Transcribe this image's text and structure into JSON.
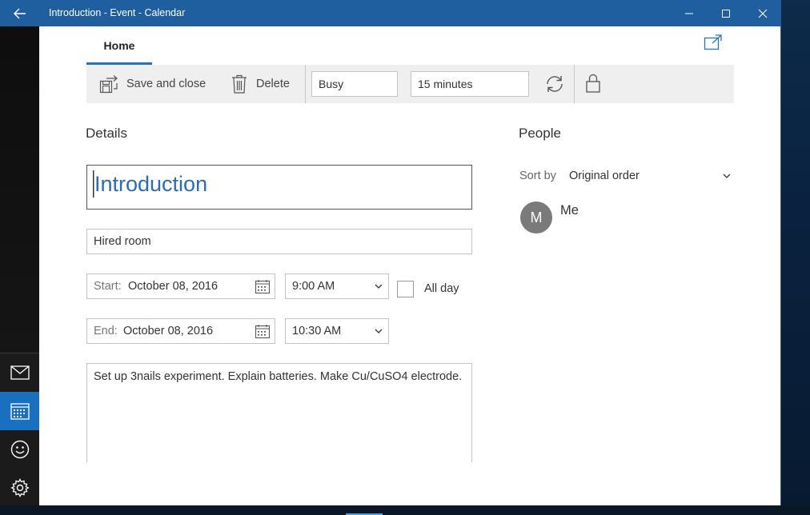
{
  "window": {
    "title": "Introduction - Event - Calendar"
  },
  "ribbon": {
    "tab_home": "Home",
    "save_close": "Save and close",
    "delete": "Delete",
    "show_as": "Busy",
    "reminder": "15 minutes"
  },
  "details": {
    "heading": "Details",
    "subject": "Introduction",
    "location": "Hired room",
    "start_label": "Start:",
    "start_date": "October 08, 2016",
    "start_time": "9:00 AM",
    "end_label": "End:",
    "end_date": "October 08, 2016",
    "end_time": "10:30 AM",
    "all_day": "All day",
    "all_day_checked": false,
    "notes": "Set up 3nails experiment.  Explain batteries. Make Cu/CuSO4 electrode."
  },
  "people": {
    "heading": "People",
    "sort_by_label": "Sort by",
    "sort_by_value": "Original order",
    "attendees": [
      {
        "initial": "M",
        "name": "Me"
      }
    ]
  },
  "colors": {
    "titlebar": "#1f5fa0",
    "accent": "#1f74c4",
    "subject_text": "#2a6cb5"
  },
  "icons": {
    "nav": [
      "mail-icon",
      "calendar-icon",
      "feedback-icon",
      "settings-icon"
    ],
    "toolbar": [
      "save-close-icon",
      "trash-icon",
      "repeat-icon",
      "lock-icon",
      "popout-icon"
    ]
  }
}
